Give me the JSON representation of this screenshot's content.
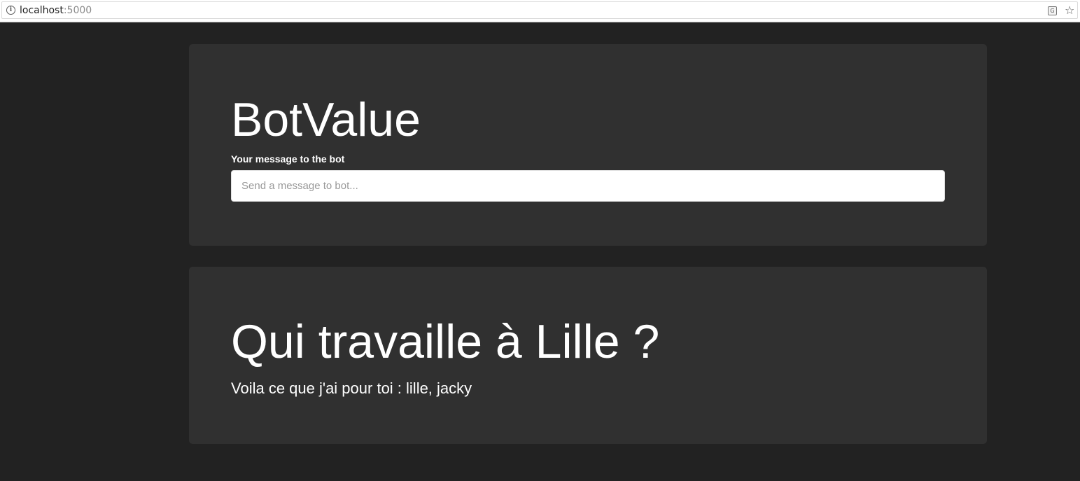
{
  "browser": {
    "url_host": "localhost",
    "url_port": ":5000",
    "info_icon": "info-icon",
    "translate_icon": "translate-icon",
    "bookmark_icon": "star-icon"
  },
  "app": {
    "title": "BotValue",
    "input_label": "Your message to the bot",
    "input_placeholder": "Send a message to bot...",
    "input_value": ""
  },
  "response": {
    "question": "Qui travaille à Lille ?",
    "answer": "Voila ce que j'ai pour toi : lille, jacky"
  },
  "colors": {
    "page_background": "#222222",
    "card_background": "#303030",
    "text": "#ffffff",
    "input_background": "#ffffff"
  }
}
